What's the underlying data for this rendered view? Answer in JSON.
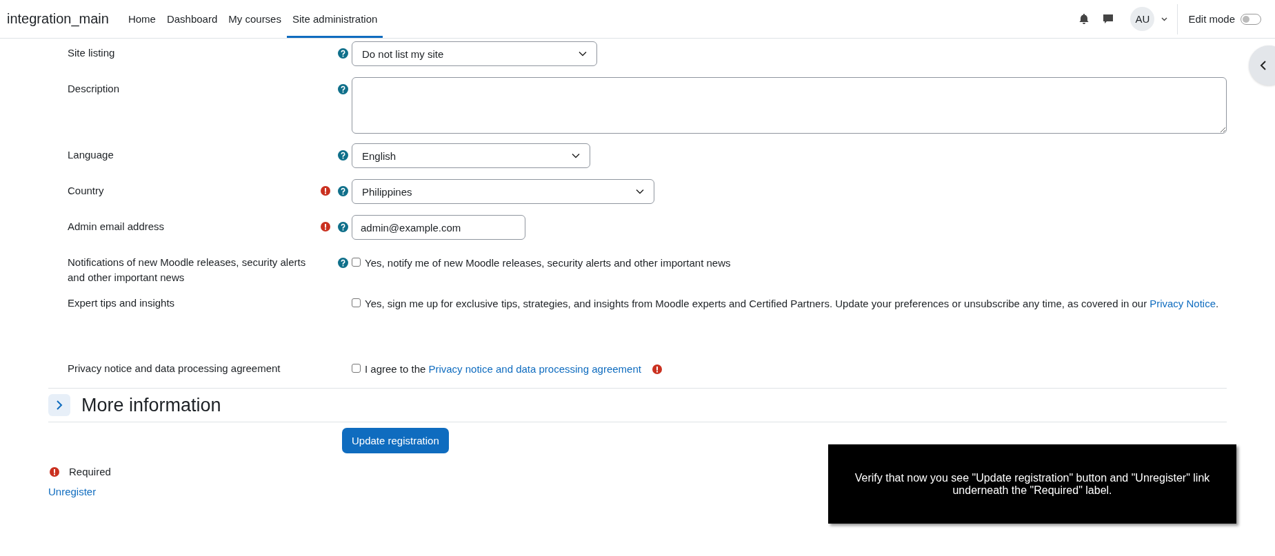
{
  "navbar": {
    "site_name": "integration_main",
    "nav": [
      {
        "label": "Home",
        "selected": false
      },
      {
        "label": "Dashboard",
        "selected": false
      },
      {
        "label": "My courses",
        "selected": false
      },
      {
        "label": "Site administration",
        "selected": true
      }
    ],
    "avatar": "AU",
    "edit_mode": {
      "label": "Edit mode",
      "on": false
    }
  },
  "fields": [
    {
      "kind": "select",
      "label": "Site listing",
      "required": false,
      "help": true,
      "value": "Do not list my site"
    },
    {
      "kind": "textarea",
      "label": "Description",
      "required": false,
      "help": true
    },
    {
      "kind": "select",
      "label": "Language",
      "required": false,
      "help": true,
      "value": "English"
    },
    {
      "kind": "select",
      "label": "Country",
      "required": true,
      "help": true,
      "value": "Philippines"
    },
    {
      "kind": "text",
      "label": "Admin email address",
      "required": true,
      "help": true,
      "value": "admin@example.com"
    },
    {
      "kind": "checkbox",
      "label": "Notifications of new Moodle releases, security alerts and other important news",
      "required": false,
      "help": true,
      "checked": false,
      "text": "Yes, notify me of new Moodle releases, security alerts and other important news"
    },
    {
      "kind": "checkbox",
      "label": "Expert tips and insights",
      "required": false,
      "help": false,
      "checked": false,
      "text": "Yes, sign me up for exclusive tips, strategies, and insights from Moodle experts and Certified Partners. Update your preferences or unsubscribe any time, as covered in our",
      "link": "Privacy Notice",
      "after": "."
    },
    {
      "kind": "checkbox",
      "label": "Privacy notice and data processing agreement",
      "required": false,
      "help": false,
      "checked": false,
      "text": "I agree to the",
      "link": "Privacy notice and data processing agreement",
      "link_required": true
    }
  ],
  "section": {
    "title": "More information",
    "expanded": false
  },
  "submit": "Update registration",
  "required_note": "Required",
  "unregister": "Unregister",
  "overlay": "Verify that now you see \"Update registration\" button and \"Unregister\" link underneath the \"Required\" label."
}
